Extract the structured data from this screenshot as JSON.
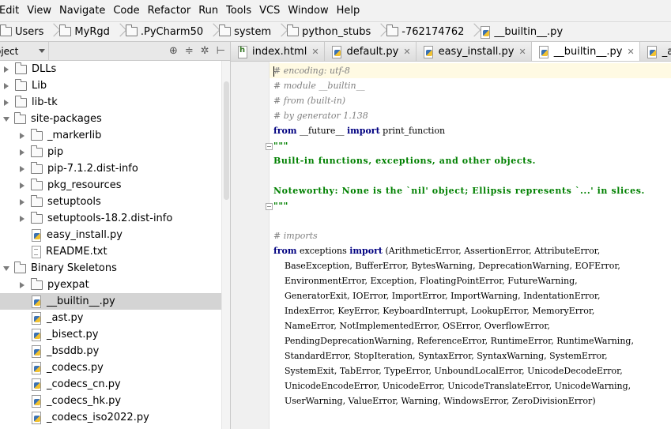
{
  "menu": [
    "Edit",
    "View",
    "Navigate",
    "Code",
    "Refactor",
    "Run",
    "Tools",
    "VCS",
    "Window",
    "Help"
  ],
  "breadcrumbs": [
    {
      "label": "Users",
      "icon": "folder-icon"
    },
    {
      "label": "MyRgd",
      "icon": "folder-icon"
    },
    {
      "label": ".PyCharm50",
      "icon": "folder-icon"
    },
    {
      "label": "system",
      "icon": "folder-icon"
    },
    {
      "label": "python_stubs",
      "icon": "folder-icon"
    },
    {
      "label": "-762174762",
      "icon": "folder-icon"
    },
    {
      "label": "__builtin__.py",
      "icon": "python-file-icon"
    }
  ],
  "project_panel": {
    "dropdown": "oject"
  },
  "tree": [
    {
      "label": "DLLs",
      "level": 0,
      "arrow": "right",
      "icon": "folder"
    },
    {
      "label": "Lib",
      "level": 0,
      "arrow": "right",
      "icon": "folder"
    },
    {
      "label": "lib-tk",
      "level": 0,
      "arrow": "right",
      "icon": "folder"
    },
    {
      "label": "site-packages",
      "level": 0,
      "arrow": "down",
      "icon": "folder"
    },
    {
      "label": "_markerlib",
      "level": 1,
      "arrow": "right",
      "icon": "folder"
    },
    {
      "label": "pip",
      "level": 1,
      "arrow": "right",
      "icon": "folder"
    },
    {
      "label": "pip-7.1.2.dist-info",
      "level": 1,
      "arrow": "right",
      "icon": "folder"
    },
    {
      "label": "pkg_resources",
      "level": 1,
      "arrow": "right",
      "icon": "folder"
    },
    {
      "label": "setuptools",
      "level": 1,
      "arrow": "right",
      "icon": "folder"
    },
    {
      "label": "setuptools-18.2.dist-info",
      "level": 1,
      "arrow": "right",
      "icon": "folder"
    },
    {
      "label": "easy_install.py",
      "level": 1,
      "arrow": "none",
      "icon": "py"
    },
    {
      "label": "README.txt",
      "level": 1,
      "arrow": "none",
      "icon": "txt"
    },
    {
      "label": "Binary Skeletons",
      "level": 0,
      "arrow": "down",
      "icon": "folder"
    },
    {
      "label": "pyexpat",
      "level": 1,
      "arrow": "right",
      "icon": "folder"
    },
    {
      "label": "__builtin__.py",
      "level": 1,
      "arrow": "none",
      "icon": "py",
      "selected": true
    },
    {
      "label": "_ast.py",
      "level": 1,
      "arrow": "none",
      "icon": "py"
    },
    {
      "label": "_bisect.py",
      "level": 1,
      "arrow": "none",
      "icon": "py"
    },
    {
      "label": "_bsddb.py",
      "level": 1,
      "arrow": "none",
      "icon": "py"
    },
    {
      "label": "_codecs.py",
      "level": 1,
      "arrow": "none",
      "icon": "py"
    },
    {
      "label": "_codecs_cn.py",
      "level": 1,
      "arrow": "none",
      "icon": "py"
    },
    {
      "label": "_codecs_hk.py",
      "level": 1,
      "arrow": "none",
      "icon": "py"
    },
    {
      "label": "_codecs_iso2022.py",
      "level": 1,
      "arrow": "none",
      "icon": "py"
    }
  ],
  "tabs": [
    {
      "label": "index.html",
      "icon": "html",
      "active": false
    },
    {
      "label": "default.py",
      "icon": "py",
      "active": false
    },
    {
      "label": "easy_install.py",
      "icon": "py",
      "active": false
    },
    {
      "label": "__builtin__.py",
      "icon": "py",
      "active": true
    },
    {
      "label": "_ast.py",
      "icon": "py",
      "active": false
    }
  ],
  "code_lines": [
    [
      {
        "t": "cmt",
        "s": "# encoding: utf-8"
      }
    ],
    [
      {
        "t": "cmt",
        "s": "# module __builtin__"
      }
    ],
    [
      {
        "t": "cmt",
        "s": "# from (built-in)"
      }
    ],
    [
      {
        "t": "cmt",
        "s": "# by generator 1.138"
      }
    ],
    [
      {
        "t": "kw",
        "s": "from"
      },
      {
        "t": "plain",
        "s": " __future__ "
      },
      {
        "t": "kw",
        "s": "import"
      },
      {
        "t": "plain",
        "s": " print_function"
      }
    ],
    [
      {
        "t": "doc",
        "s": "\"\"\""
      }
    ],
    [
      {
        "t": "doc",
        "s": "Built-in functions, exceptions, and other objects."
      }
    ],
    [
      {
        "t": "plain",
        "s": ""
      }
    ],
    [
      {
        "t": "doc",
        "s": "Noteworthy: None is the `nil' object; Ellipsis represents `...' in slices."
      }
    ],
    [
      {
        "t": "doc",
        "s": "\"\"\""
      }
    ],
    [
      {
        "t": "plain",
        "s": ""
      }
    ],
    [
      {
        "t": "cmt",
        "s": "# imports"
      }
    ],
    [
      {
        "t": "kw",
        "s": "from"
      },
      {
        "t": "plain",
        "s": " exceptions "
      },
      {
        "t": "kw",
        "s": "import"
      },
      {
        "t": "plain",
        "s": " (ArithmeticError, AssertionError, AttributeError,"
      }
    ],
    [
      {
        "t": "plain",
        "s": "    BaseException, BufferError, BytesWarning, DeprecationWarning, EOFError,"
      }
    ],
    [
      {
        "t": "plain",
        "s": "    EnvironmentError, Exception, FloatingPointError, FutureWarning,"
      }
    ],
    [
      {
        "t": "plain",
        "s": "    GeneratorExit, IOError, ImportError, ImportWarning, IndentationError,"
      }
    ],
    [
      {
        "t": "plain",
        "s": "    IndexError, KeyError, KeyboardInterrupt, LookupError, MemoryError,"
      }
    ],
    [
      {
        "t": "plain",
        "s": "    NameError, NotImplementedError, OSError, OverflowError,"
      }
    ],
    [
      {
        "t": "plain",
        "s": "    PendingDeprecationWarning, ReferenceError, RuntimeError, RuntimeWarning,"
      }
    ],
    [
      {
        "t": "plain",
        "s": "    StandardError, StopIteration, SyntaxError, SyntaxWarning, SystemError,"
      }
    ],
    [
      {
        "t": "plain",
        "s": "    SystemExit, TabError, TypeError, UnboundLocalError, UnicodeDecodeError,"
      }
    ],
    [
      {
        "t": "plain",
        "s": "    UnicodeEncodeError, UnicodeError, UnicodeTranslateError, UnicodeWarning,"
      }
    ],
    [
      {
        "t": "plain",
        "s": "    UserWarning, ValueError, Warning, WindowsError, ZeroDivisionError)"
      }
    ]
  ]
}
